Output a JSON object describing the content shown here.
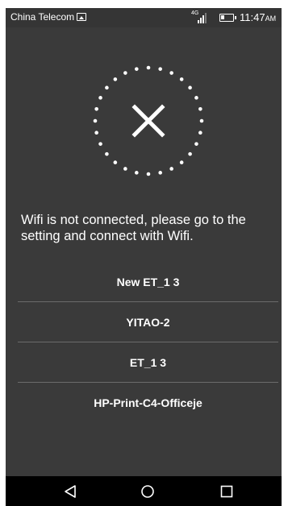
{
  "status_bar": {
    "carrier": "China Telecom",
    "network_type": "4G",
    "time": "11:47",
    "ampm": "AM",
    "icons": [
      "image-notification-icon",
      "signal-icon",
      "battery-icon"
    ]
  },
  "status_graphic": {
    "icon": "close-icon",
    "color": "#ffffff"
  },
  "message": "Wifi is not connected, please go to the setting and connect with Wifi.",
  "wifi_list": [
    {
      "ssid": "New ET_1 3"
    },
    {
      "ssid": "YITAO-2"
    },
    {
      "ssid": "ET_1 3"
    },
    {
      "ssid": "HP-Print-C4-Officeje"
    }
  ],
  "nav_bar": {
    "buttons": [
      "back-icon",
      "home-icon",
      "recents-icon"
    ]
  },
  "colors": {
    "background": "#3a3a3a",
    "divider": "#6b6b6b",
    "nav_background": "#000000"
  }
}
